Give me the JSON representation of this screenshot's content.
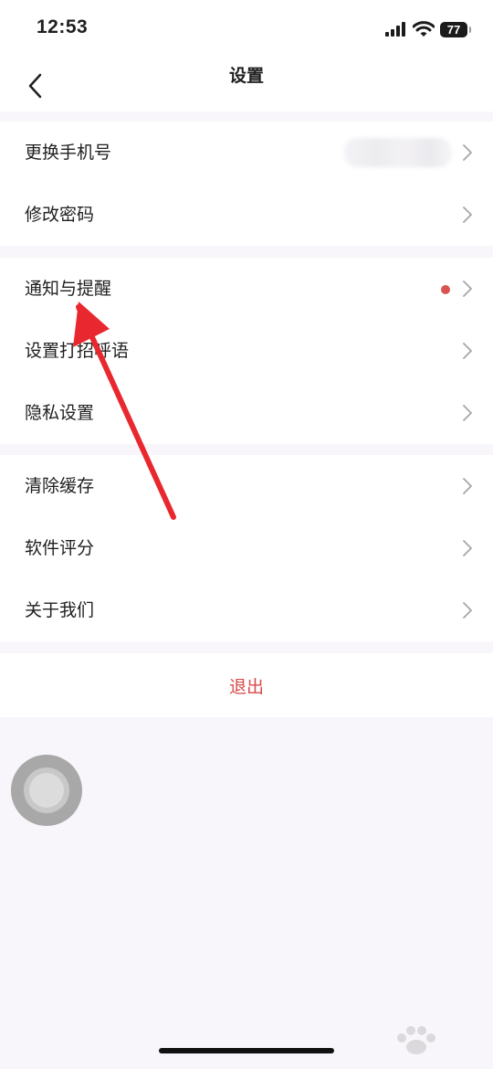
{
  "status_bar": {
    "time": "12:53",
    "battery": "77"
  },
  "header": {
    "title": "设置"
  },
  "groups": [
    {
      "items": [
        {
          "label": "更换手机号"
        },
        {
          "label": "修改密码"
        }
      ]
    },
    {
      "items": [
        {
          "label": "通知与提醒"
        },
        {
          "label": "设置打招呼语"
        },
        {
          "label": "隐私设置"
        }
      ]
    },
    {
      "items": [
        {
          "label": "清除缓存"
        },
        {
          "label": "软件评分"
        },
        {
          "label": "关于我们"
        }
      ]
    }
  ],
  "logout_label": "退出",
  "colors": {
    "accent_red": "#d94a4a",
    "badge_red": "#d9534f",
    "annotation_red": "#e8282e",
    "background": "#f8f6fa"
  },
  "icons": {
    "back": "chevron-left-icon",
    "row_arrow": "chevron-right-icon",
    "signal": "cellular-signal-icon",
    "wifi": "wifi-icon",
    "battery": "battery-icon",
    "assistive_touch": "assistive-touch-icon"
  }
}
